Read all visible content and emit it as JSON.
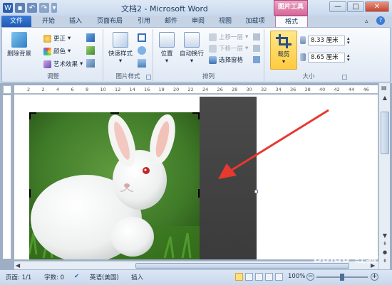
{
  "window": {
    "title": "文档2 - Microsoft Word",
    "context_tools": "图片工具"
  },
  "tabs": [
    {
      "label": "文件"
    },
    {
      "label": "开始"
    },
    {
      "label": "插入"
    },
    {
      "label": "页面布局"
    },
    {
      "label": "引用"
    },
    {
      "label": "邮件"
    },
    {
      "label": "审阅"
    },
    {
      "label": "视图"
    },
    {
      "label": "加载项"
    },
    {
      "label": "格式"
    }
  ],
  "ribbon": {
    "adjust": {
      "remove_bg": "删除背景",
      "correct": "更正",
      "color": "颜色",
      "effects": "艺术效果",
      "label": "调整"
    },
    "styles": {
      "quick_styles": "快速样式",
      "label": "图片样式"
    },
    "arrange": {
      "position": "位置",
      "wrap": "自动换行",
      "bring_forward": "上移一层",
      "send_backward": "下移一层",
      "selection_pane": "选择窗格",
      "label": "排列"
    },
    "size": {
      "crop": "裁剪",
      "height": "8.33 厘米",
      "width": "8.65 厘米",
      "label": "大小"
    }
  },
  "ruler": {
    "ticks": [
      "2",
      "2",
      "4",
      "6",
      "8",
      "10",
      "12",
      "14",
      "16",
      "18",
      "20",
      "22",
      "24",
      "26",
      "28",
      "30",
      "32",
      "34",
      "36",
      "38",
      "40",
      "42",
      "44",
      "46"
    ]
  },
  "status": {
    "page": "页面: 1/1",
    "words": "字数: 0",
    "language": "英语(美国)",
    "mode": "插入",
    "zoom": "100%"
  },
  "watermark": "Baidu 经验"
}
